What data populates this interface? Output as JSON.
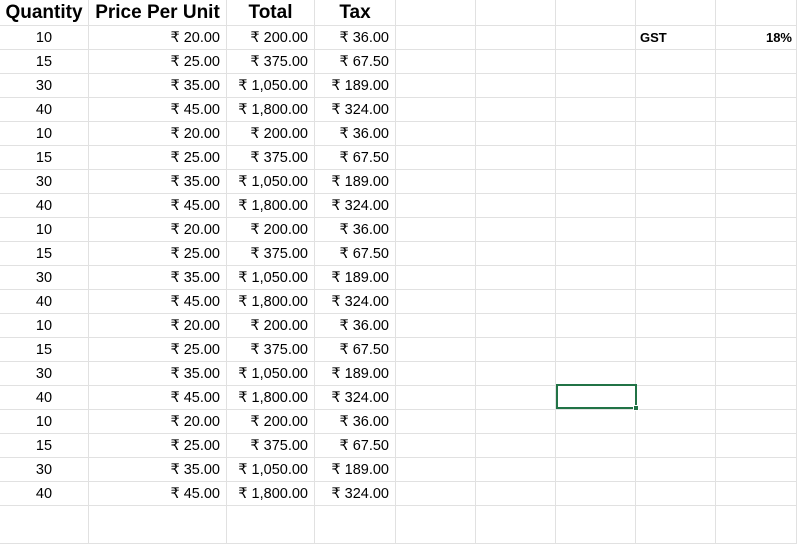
{
  "sheet": {
    "headers": [
      "Quantity",
      "Price Per Unit",
      "Total",
      "Tax"
    ],
    "rows": [
      [
        "10",
        "₹ 20.00",
        "₹ 200.00",
        "₹ 36.00"
      ],
      [
        "15",
        "₹ 25.00",
        "₹ 375.00",
        "₹ 67.50"
      ],
      [
        "30",
        "₹ 35.00",
        "₹ 1,050.00",
        "₹ 189.00"
      ],
      [
        "40",
        "₹ 45.00",
        "₹ 1,800.00",
        "₹ 324.00"
      ],
      [
        "10",
        "₹ 20.00",
        "₹ 200.00",
        "₹ 36.00"
      ],
      [
        "15",
        "₹ 25.00",
        "₹ 375.00",
        "₹ 67.50"
      ],
      [
        "30",
        "₹ 35.00",
        "₹ 1,050.00",
        "₹ 189.00"
      ],
      [
        "40",
        "₹ 45.00",
        "₹ 1,800.00",
        "₹ 324.00"
      ],
      [
        "10",
        "₹ 20.00",
        "₹ 200.00",
        "₹ 36.00"
      ],
      [
        "15",
        "₹ 25.00",
        "₹ 375.00",
        "₹ 67.50"
      ],
      [
        "30",
        "₹ 35.00",
        "₹ 1,050.00",
        "₹ 189.00"
      ],
      [
        "40",
        "₹ 45.00",
        "₹ 1,800.00",
        "₹ 324.00"
      ],
      [
        "10",
        "₹ 20.00",
        "₹ 200.00",
        "₹ 36.00"
      ],
      [
        "15",
        "₹ 25.00",
        "₹ 375.00",
        "₹ 67.50"
      ],
      [
        "30",
        "₹ 35.00",
        "₹ 1,050.00",
        "₹ 189.00"
      ],
      [
        "40",
        "₹ 45.00",
        "₹ 1,800.00",
        "₹ 324.00"
      ],
      [
        "10",
        "₹ 20.00",
        "₹ 200.00",
        "₹ 36.00"
      ],
      [
        "15",
        "₹ 25.00",
        "₹ 375.00",
        "₹ 67.50"
      ],
      [
        "30",
        "₹ 35.00",
        "₹ 1,050.00",
        "₹ 189.00"
      ],
      [
        "40",
        "₹ 45.00",
        "₹ 1,800.00",
        "₹ 324.00"
      ]
    ],
    "gst_label": "GST",
    "gst_value": "18%"
  },
  "colors": {
    "gridline": "#e1e1e1",
    "selection": "#217346"
  }
}
